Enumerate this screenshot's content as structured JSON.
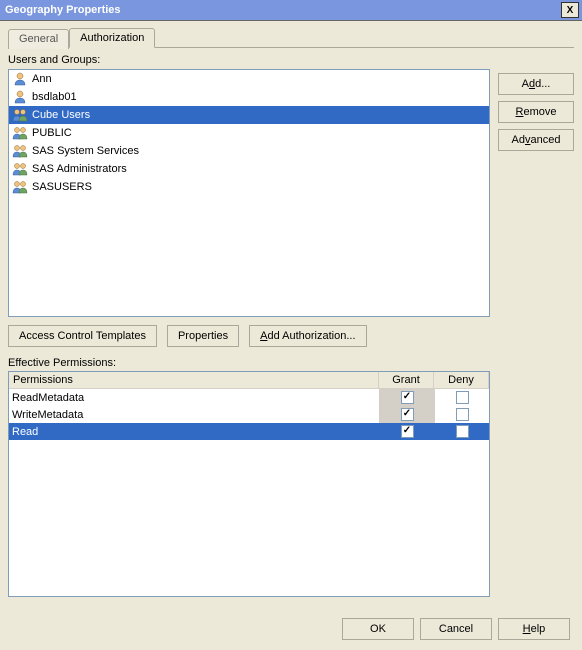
{
  "window": {
    "title": "Geography Properties",
    "close_label": "X"
  },
  "tabs": {
    "general": "General",
    "authorization": "Authorization",
    "active": "authorization"
  },
  "users_groups_label": "Users and Groups:",
  "list": {
    "items": [
      {
        "name": "Ann",
        "type": "user"
      },
      {
        "name": "bsdlab01",
        "type": "user"
      },
      {
        "name": "Cube Users",
        "type": "group",
        "selected": true
      },
      {
        "name": "PUBLIC",
        "type": "group"
      },
      {
        "name": "SAS System Services",
        "type": "group"
      },
      {
        "name": "SAS Administrators",
        "type": "group"
      },
      {
        "name": "SASUSERS",
        "type": "group"
      }
    ]
  },
  "side_buttons": {
    "add": "Add...",
    "remove": "Remove",
    "advanced": "Advanced"
  },
  "row_buttons": {
    "act": "Access Control Templates",
    "properties": "Properties",
    "add_auth_prefix": "A",
    "add_auth_rest": "dd Authorization..."
  },
  "perms_label": "Effective Permissions:",
  "perms": {
    "headers": {
      "perm": "Permissions",
      "grant": "Grant",
      "deny": "Deny"
    },
    "rows": [
      {
        "name": "ReadMetadata",
        "grant": true,
        "deny": false,
        "grant_shaded": true,
        "deny_shaded": false,
        "sel": false
      },
      {
        "name": "WriteMetadata",
        "grant": true,
        "deny": false,
        "grant_shaded": true,
        "deny_shaded": false,
        "sel": false
      },
      {
        "name": "Read",
        "grant": true,
        "deny": false,
        "grant_shaded": false,
        "deny_shaded": false,
        "sel": true
      }
    ]
  },
  "footer": {
    "ok": "OK",
    "cancel": "Cancel",
    "help_prefix": "H",
    "help_rest": "elp"
  }
}
